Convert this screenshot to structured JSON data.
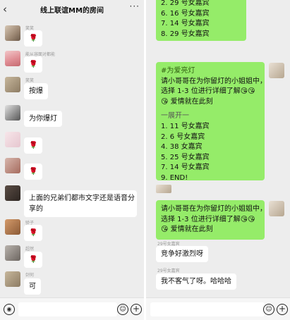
{
  "chat": {
    "title": "线上联谊MM的房间",
    "back_icon": "‹",
    "more_icon": "···"
  },
  "left_messages": {
    "m1": {
      "nick": "笑笑",
      "text": "🌹"
    },
    "m2": {
      "nick": "能从容面对都能",
      "text": "🌹"
    },
    "m3": {
      "nick": "笑笑",
      "text": "按爆"
    },
    "m4": {
      "nick": "",
      "text": "为你爆灯"
    },
    "m5": {
      "nick": "",
      "text": "🌹"
    },
    "m6": {
      "nick": "",
      "text": "🌹"
    },
    "m7": {
      "nick": "",
      "text_line1": "上面的兄弟们都市文字还是语音分",
      "text_line2": "享的"
    },
    "m8": {
      "nick": "骄子",
      "text": "🌹"
    },
    "m9": {
      "nick": "超然",
      "text": "🌹"
    },
    "m10": {
      "nick": "剑何",
      "text": "可"
    }
  },
  "right_messages": {
    "list_top": [
      "2. 29 号女嘉宾",
      "6. 16 号女嘉宾",
      "7. 14 号女嘉宾",
      "8. 29 号女嘉宾"
    ],
    "post": {
      "tag": "#为爱亮灯",
      "intro1": "请小哥哥在为你留灯的小姐姐中，",
      "intro2": "选择 1-3 位进行详细了解😘😘",
      "intro3": "😘 爱情就在此刻",
      "divider": "一展开一",
      "items": [
        "1. 11 号女嘉宾",
        "2. 6 号女嘉宾",
        "4. 38 女嘉宾",
        "5. 25 号女嘉宾",
        "7. 14 号女嘉宾",
        "9. END!"
      ]
    },
    "reminder": {
      "line1": "请小哥哥在为你留灯的小姐姐中，",
      "line2": "选择 1-3 位进行详细了解😘😘",
      "line3": "😘 爱情就在此刻"
    },
    "m1": {
      "nick": "29号女嘉宾",
      "text": "竞争好激烈呀"
    },
    "m2": {
      "nick": "29号女嘉宾",
      "text": "我不客气了呀。哈哈哈"
    }
  },
  "input": {
    "voice_icon": "◉",
    "emoji_icon": "☺",
    "plus_icon": "+"
  },
  "colors": {
    "background": "#ededed",
    "sent_bubble": "#95ec69",
    "received_bubble": "#ffffff"
  }
}
